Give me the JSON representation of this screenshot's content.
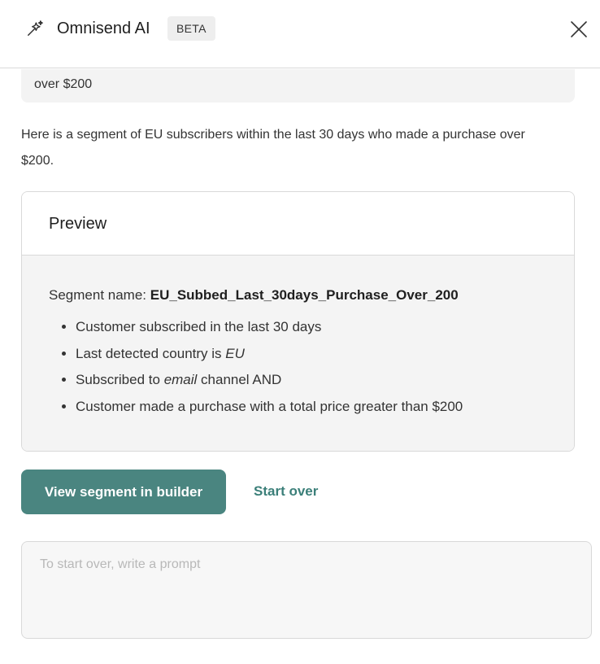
{
  "header": {
    "title": "Omnisend AI",
    "badge": "BETA",
    "icon": "sparkle-wand-icon",
    "close_icon": "close-icon"
  },
  "conversation": {
    "user_message_tail": "over $200",
    "ai_reply": "Here is a segment of EU subscribers within the last 30 days who made a purchase over $200."
  },
  "preview": {
    "title": "Preview",
    "segment_label": "Segment name: ",
    "segment_name": "EU_Subbed_Last_30days_Purchase_Over_200",
    "rules": [
      {
        "text": "Customer subscribed in the last 30 days"
      },
      {
        "before": "Last detected country is ",
        "em": "EU",
        "after": ""
      },
      {
        "before": "Subscribed to ",
        "em": "email",
        "after": " channel AND"
      },
      {
        "text": "Customer made a purchase with a total price greater than $200"
      }
    ]
  },
  "actions": {
    "primary_label": "View segment in builder",
    "secondary_label": "Start over"
  },
  "prompt": {
    "placeholder": "To start over, write a prompt"
  },
  "colors": {
    "accent": "#4a8580",
    "link": "#3b7f79",
    "bubble_bg": "#f3f3f3",
    "card_body_bg": "#f4f4f4",
    "border": "#d9d9d9"
  }
}
